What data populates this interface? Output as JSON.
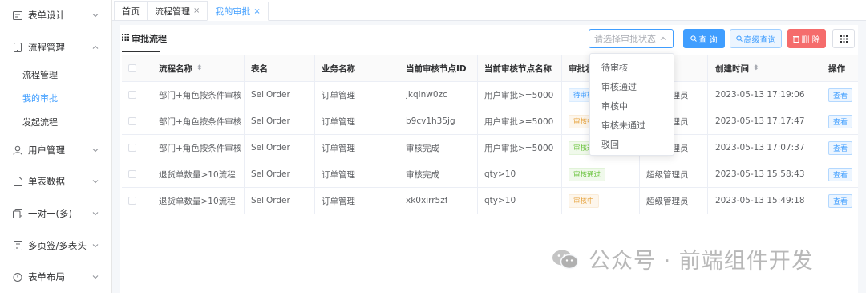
{
  "sidebar": {
    "items": [
      {
        "label": "表单设计",
        "icon": "form-icon"
      },
      {
        "label": "流程管理",
        "icon": "phone-icon"
      },
      {
        "label": "用户管理",
        "icon": "user-icon"
      },
      {
        "label": "单表数据",
        "icon": "doc-icon"
      },
      {
        "label": "一对一(多)",
        "icon": "copy-icon"
      },
      {
        "label": "多页签/多表头",
        "icon": "list-icon"
      },
      {
        "label": "表单布局",
        "icon": "clock-icon"
      }
    ],
    "sub_items": [
      {
        "label": "流程管理"
      },
      {
        "label": "我的审批"
      },
      {
        "label": "发起流程"
      }
    ]
  },
  "tabs": [
    {
      "label": "首页"
    },
    {
      "label": "流程管理",
      "close": "×"
    },
    {
      "label": "我的审批",
      "close": "×"
    }
  ],
  "panel": {
    "title": "审批流程",
    "status_select": {
      "placeholder": "请选择审批状态"
    },
    "buttons": {
      "query": "查 询",
      "advanced": "高级查询",
      "delete": "删 除"
    }
  },
  "table": {
    "headers": [
      "流程名称",
      "表名",
      "业务名称",
      "当前审核节点ID",
      "当前审核节点名称",
      "审批状态",
      "",
      "创建时间",
      "操作"
    ],
    "rows": [
      {
        "name": "部门+角色按条件审核",
        "table": "SellOrder",
        "biz": "订单管理",
        "node_id": "jkqinw0zc",
        "node_name": "用户审批>=5000",
        "status": "待审核",
        "status_type": "pending",
        "creator": "超级管理员",
        "created": "2023-05-13 17:19:06",
        "action": "查看"
      },
      {
        "name": "部门+角色按条件审核",
        "table": "SellOrder",
        "biz": "订单管理",
        "node_id": "b9cv1h35jg",
        "node_name": "用户审批>=5000",
        "status": "审核中",
        "status_type": "ing",
        "creator": "超级管理员",
        "created": "2023-05-13 17:17:47",
        "action": "查看"
      },
      {
        "name": "部门+角色按条件审核",
        "table": "SellOrder",
        "biz": "订单管理",
        "node_id": "审核完成",
        "node_name": "用户审批>=5000",
        "status": "审核通过",
        "status_type": "pass",
        "creator": "超级管理员",
        "created": "2023-05-13 17:07:37",
        "action": "查看"
      },
      {
        "name": "退货单数量>10流程",
        "table": "SellOrder",
        "biz": "订单管理",
        "node_id": "审核完成",
        "node_name": "qty>10",
        "status": "审核通过",
        "status_type": "pass",
        "creator": "超级管理员",
        "created": "2023-05-13 15:58:43",
        "action": "查看"
      },
      {
        "name": "退货单数量>10流程",
        "table": "SellOrder",
        "biz": "订单管理",
        "node_id": "xk0xirr5zf",
        "node_name": "qty>10",
        "status": "审核中",
        "status_type": "ing",
        "creator": "超级管理员",
        "created": "2023-05-13 15:49:18",
        "action": "查看"
      }
    ]
  },
  "dropdown": {
    "options": [
      "待审核",
      "审核通过",
      "审核中",
      "审核未通过",
      "驳回"
    ]
  },
  "watermark": {
    "text": "公众号 · 前端组件开发"
  },
  "colors": {
    "primary": "#409eff",
    "danger": "#f56c6c",
    "success": "#67c23a",
    "warning": "#e6a23c"
  }
}
